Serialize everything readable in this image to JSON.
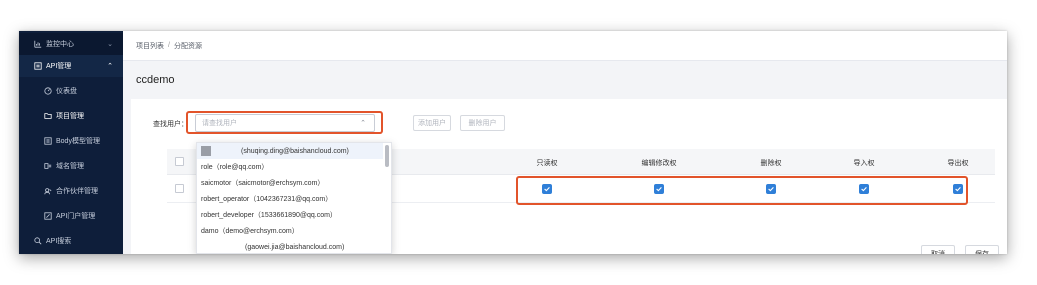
{
  "sidebar": {
    "items": [
      {
        "label": "监控中心",
        "icon": "chart-icon",
        "caret": "⌄"
      },
      {
        "label": "API管理",
        "icon": "api-icon",
        "caret": "⌃"
      },
      {
        "label": "仪表盘",
        "icon": "dashboard-icon"
      },
      {
        "label": "项目管理",
        "icon": "folder-icon"
      },
      {
        "label": "Body模型管理",
        "icon": "list-icon"
      },
      {
        "label": "域名管理",
        "icon": "domain-icon"
      },
      {
        "label": "合作伙伴管理",
        "icon": "partner-icon"
      },
      {
        "label": "API门户管理",
        "icon": "edit-icon"
      },
      {
        "label": "API搜索",
        "icon": "search-icon"
      }
    ]
  },
  "breadcrumb": {
    "root": "项目列表",
    "sep": "/",
    "current": "分配资源"
  },
  "page_title": "ccdemo",
  "search": {
    "label": "查找用户：",
    "placeholder": "请查找用户",
    "chevron": "⌃"
  },
  "buttons": {
    "add_user": "添加用户",
    "delete_user": "删除用户",
    "cancel": "取消",
    "save": "保存"
  },
  "table": {
    "columns": [
      "只读权",
      "编辑修改权",
      "删除权",
      "导入权",
      "导出权"
    ],
    "row_text": "m)",
    "row_checked": [
      true,
      true,
      true,
      true,
      true
    ]
  },
  "dropdown": {
    "items": [
      {
        "label": "(shuqing.ding@baishancloud.com)"
      },
      {
        "label": "role（role@qq.com）"
      },
      {
        "label": "saicmotor（saicmotor@erchsym.com）"
      },
      {
        "label": "robert_operator（1042367231@qq.com）"
      },
      {
        "label": "robert_developer（1533661890@qq.com）"
      },
      {
        "label": "damo（demo@erchsym.com）"
      },
      {
        "label": "(gaowei.jia@baishancloud.com)"
      }
    ]
  },
  "colors": {
    "sidebar": "#0e1e3a",
    "accent": "#2f7fd8",
    "highlight": "#e2542b"
  }
}
